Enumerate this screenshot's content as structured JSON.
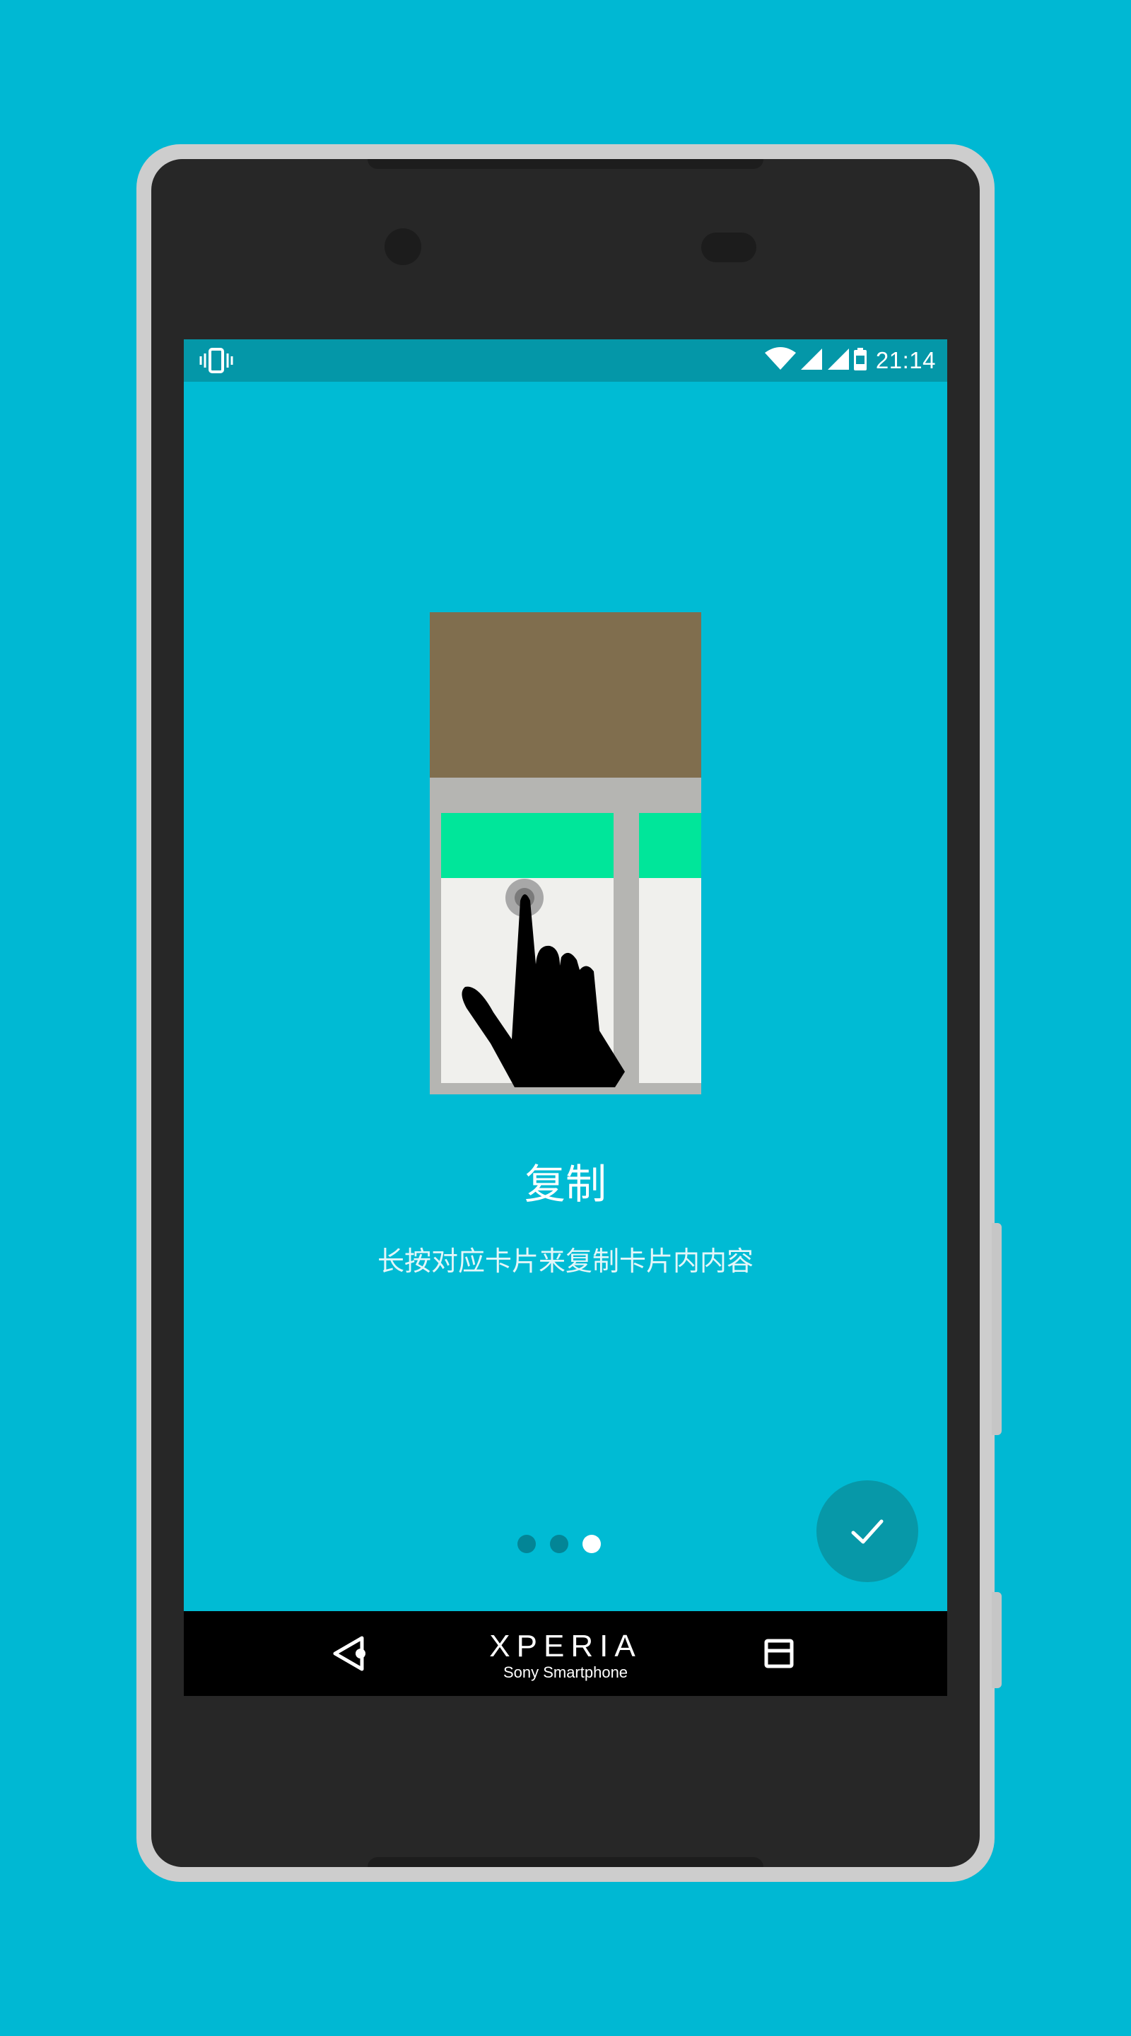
{
  "status_bar": {
    "time": "21:14",
    "left_icon": "vibrate-icon",
    "right_icons": [
      "wifi-icon",
      "signal-icon",
      "signal-icon",
      "battery-icon"
    ]
  },
  "onboarding": {
    "title": "复制",
    "description": "长按对应卡片来复制卡片内内容",
    "page_indicator": {
      "total": 3,
      "current": 3
    },
    "confirm_icon": "checkmark-icon"
  },
  "nav_bar": {
    "back_icon": "back-icon",
    "brand_name": "XPERIA",
    "brand_tagline": "Sony Smartphone",
    "recents_icon": "recents-icon"
  },
  "colors": {
    "background": "#00b8d3",
    "status_bar": "#0497a8",
    "fab": "#0798a8",
    "card_header": "#806e4e",
    "card_accent": "#00e69a"
  }
}
